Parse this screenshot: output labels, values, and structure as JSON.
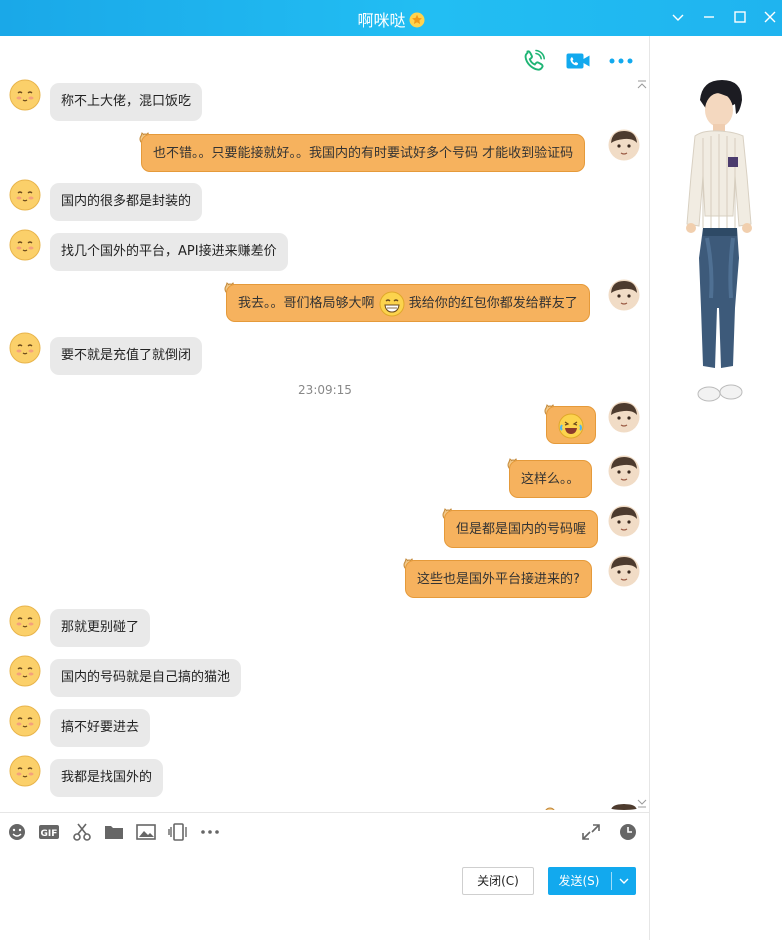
{
  "window": {
    "title": "啊咪哒"
  },
  "messages": [
    {
      "side": "left",
      "text": "称不上大佬，混口饭吃"
    },
    {
      "side": "right",
      "text": "也不错。。只要能接就好。。我国内的有时要试好多个号码 才能收到验证码"
    },
    {
      "side": "left",
      "text": "国内的很多都是封装的"
    },
    {
      "side": "left",
      "text": "找几个国外的平台，API接进来赚差价"
    },
    {
      "side": "right",
      "text_before": "我去。。哥们格局够大啊",
      "text_after": "我给你的红包你都发给群友了"
    },
    {
      "side": "left",
      "text": "要不就是充值了就倒闭"
    },
    {
      "side": "right",
      "text": "这样么。。"
    },
    {
      "side": "right",
      "text": "但是都是国内的号码喔"
    },
    {
      "side": "right",
      "text": "这些也是国外平台接进来的?"
    },
    {
      "side": "left",
      "text": "那就更别碰了"
    },
    {
      "side": "left",
      "text": "国内的号码就是自己搞的猫池"
    },
    {
      "side": "left",
      "text": "搞不好要进去"
    },
    {
      "side": "left",
      "text": "我都是找国外的"
    }
  ],
  "timestamp": "23:09:15",
  "buttons": {
    "close": "关闭(C)",
    "send": "发送(S)"
  },
  "colors": {
    "titlebar": "#1fb4ef",
    "bubble_right": "#f6b25e",
    "bubble_left": "#e9e9e9",
    "send": "#12a9ee"
  }
}
